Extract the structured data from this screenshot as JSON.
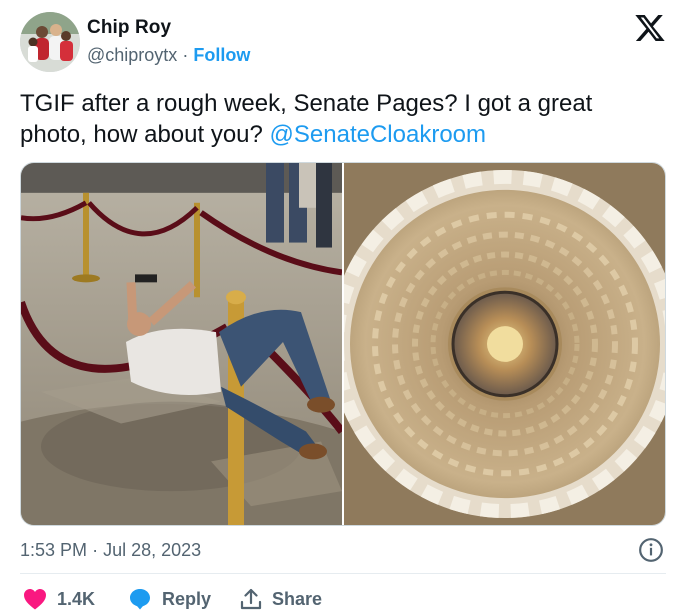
{
  "author": {
    "name": "Chip Roy",
    "handle": "@chiproytx",
    "separator": "·",
    "follow_label": "Follow"
  },
  "tweet": {
    "text_before": "TGIF after a rough week, Senate Pages?  I got a great photo, how about you? ",
    "mention": "@SenateCloakroom"
  },
  "meta": {
    "time": "1:53 PM",
    "separator": "·",
    "date": "Jul 28, 2023"
  },
  "actions": {
    "likes": "1.4K",
    "reply_label": "Reply",
    "share_label": "Share"
  },
  "icons": {
    "logo": "x-logo-icon",
    "info": "info-icon",
    "like": "heart-icon",
    "reply": "reply-bubble-icon",
    "share": "share-upload-icon"
  },
  "colors": {
    "link": "#1d9bf0",
    "secondary_text": "#536471",
    "like": "#f91880",
    "text": "#0f1419"
  }
}
